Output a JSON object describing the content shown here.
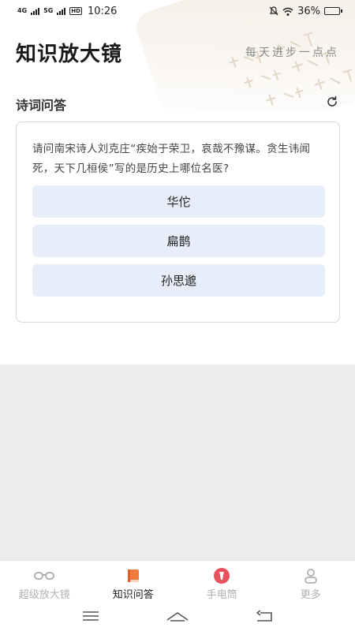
{
  "status_bar": {
    "net1": "4G",
    "net2": "5G",
    "hd": "HD",
    "time": "10:26",
    "battery": "36%",
    "battery_level": 0.36
  },
  "header": {
    "title": "知识放大镜",
    "slogan": "每天进步一点点"
  },
  "section": {
    "title": "诗词问答"
  },
  "quiz": {
    "question": "请问南宋诗人刘克庄“疾始于荣卫，哀哉不豫谋。贪生讳闻死，天下几桓侯”写的是历史上哪位名医?",
    "options": [
      "华佗",
      "扁鹊",
      "孙思邈"
    ]
  },
  "tabs": [
    {
      "label": "超级放大镜",
      "icon": "glasses-icon",
      "active": false
    },
    {
      "label": "知识问答",
      "icon": "book-icon",
      "active": true
    },
    {
      "label": "手电筒",
      "icon": "flashlight-icon",
      "active": false
    },
    {
      "label": "更多",
      "icon": "user-icon",
      "active": false
    }
  ],
  "colors": {
    "accent": "#f07a3c",
    "flashlight": "#e8505b",
    "option_bg": "#e8eef9",
    "gray_area": "#ececec"
  }
}
